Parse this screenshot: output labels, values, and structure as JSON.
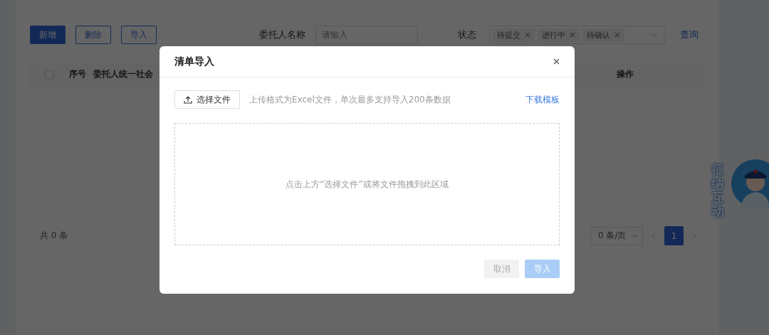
{
  "page": {
    "toolbar_buttons": [
      {
        "label": "新增",
        "kind": "primary"
      },
      {
        "label": "删除",
        "kind": "default"
      },
      {
        "label": "导入",
        "kind": "default"
      }
    ],
    "filters": {
      "name_label": "委托人名称",
      "name_placeholder": "请输入",
      "status_label": "状态",
      "status_tags": [
        "待提交",
        "进行中",
        "待确认"
      ],
      "query_link": "查询"
    },
    "table": {
      "select_all": {
        "checked": false
      },
      "columns": [
        "序号",
        "委托人统一社会",
        "操作"
      ]
    },
    "total": "共 0 条",
    "pagination": {
      "page_size": "0 条/页",
      "pages": [
        {
          "label": "1",
          "selected": true
        }
      ]
    }
  },
  "widget": {
    "label": "征纳互动"
  },
  "dialog": {
    "title": "清单导入",
    "choose_file_button": "选择文件",
    "hint": "上传格式为Excel文件，单次最多支持导入200条数据",
    "template_link": "下载模板",
    "drop_hint": "点击上方“选择文件”或将文件拖拽到此区域",
    "buttons": [
      {
        "label": "取消",
        "kind": "default",
        "disabled": true
      },
      {
        "label": "导入",
        "kind": "primary",
        "disabled": true
      }
    ]
  }
}
